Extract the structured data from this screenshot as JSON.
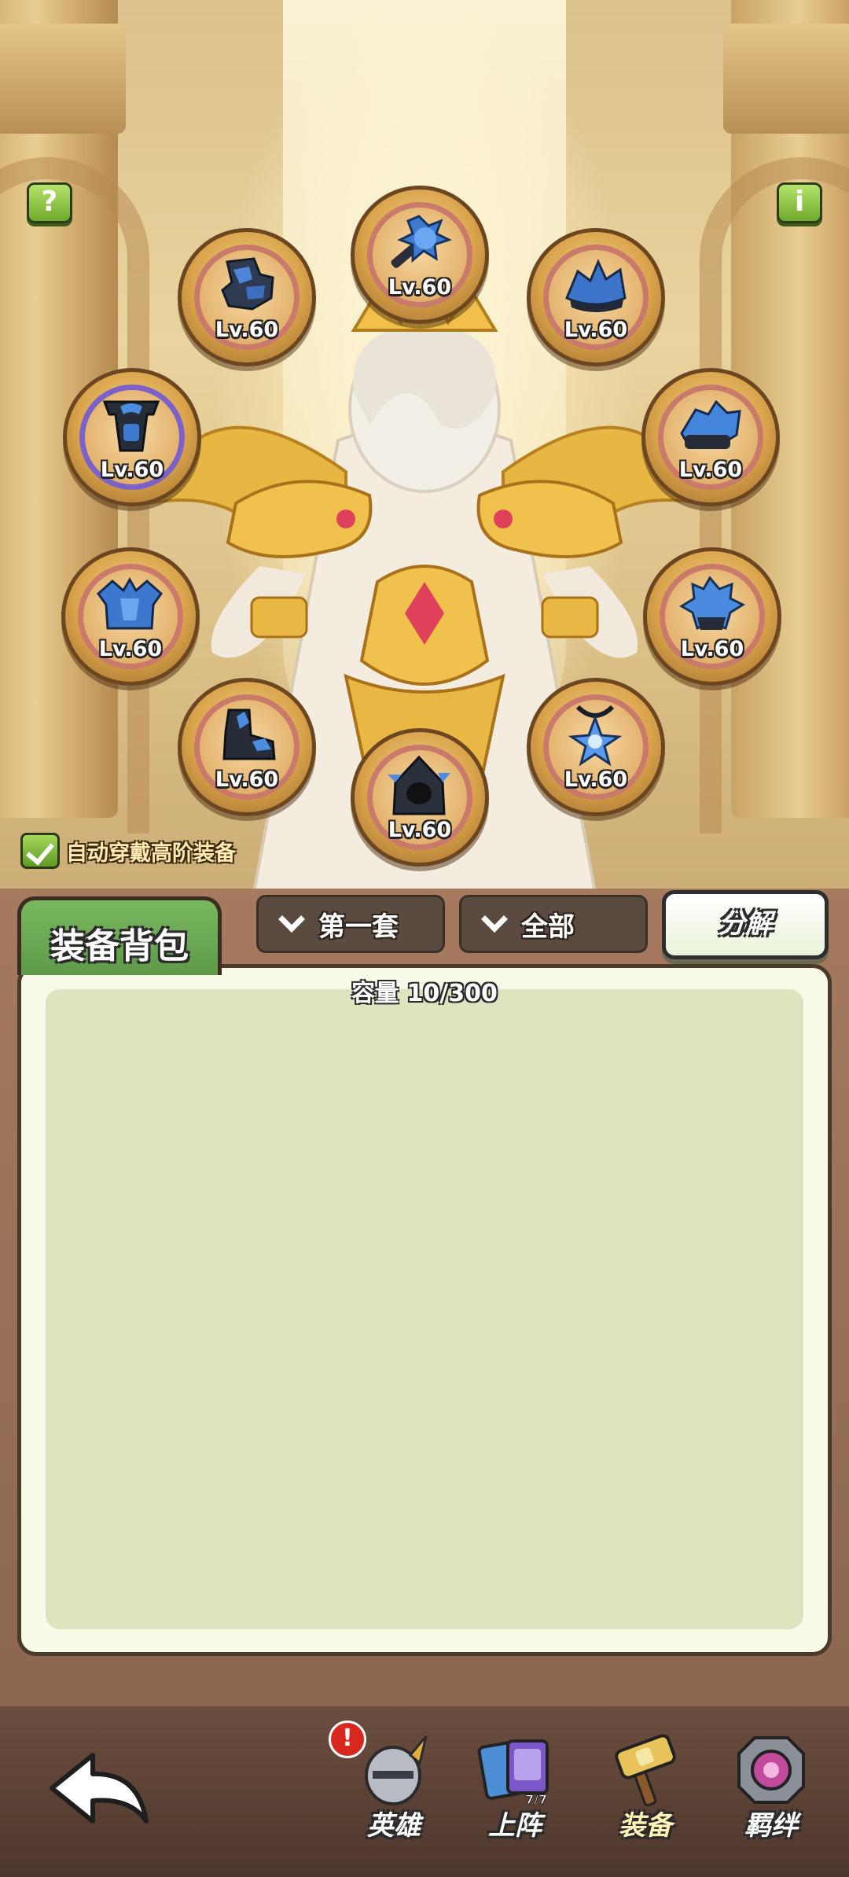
{
  "corner": {
    "help_label": "?",
    "info_label": "i"
  },
  "slots": [
    {
      "level": "Lv.60",
      "icon": "mace-icon",
      "rim": "red"
    },
    {
      "level": "Lv.60",
      "icon": "leg-armor-icon",
      "rim": "gold"
    },
    {
      "level": "Lv.60",
      "icon": "shoulder-armor-icon",
      "rim": "gold"
    },
    {
      "level": "Lv.60",
      "icon": "helmet-icon",
      "rim": "purple"
    },
    {
      "level": "Lv.60",
      "icon": "gauntlet-icon",
      "rim": "red"
    },
    {
      "level": "Lv.60",
      "icon": "chest-armor-icon",
      "rim": "gold"
    },
    {
      "level": "Lv.60",
      "icon": "crystal-bracer-icon",
      "rim": "gold"
    },
    {
      "level": "Lv.60",
      "icon": "boot-icon",
      "rim": "gold"
    },
    {
      "level": "Lv.60",
      "icon": "amulet-icon",
      "rim": "red"
    },
    {
      "level": "Lv.60",
      "icon": "hood-icon",
      "rim": "red"
    }
  ],
  "auto_equip": {
    "label": "自动穿戴高阶装备",
    "checked": true
  },
  "bag": {
    "tab_label": "装备背包",
    "set_dropdown": "第一套",
    "filter_dropdown": "全部",
    "dismantle_label": "分解",
    "capacity": "容量 10/300"
  },
  "nav": {
    "back_icon": "back-arrow-icon",
    "alert": "!",
    "items": [
      {
        "label": "英雄",
        "icon": "knight-helmet-icon"
      },
      {
        "label": "上阵",
        "icon": "cards-icon",
        "badge": "7/7"
      },
      {
        "label": "装备",
        "icon": "hammer-icon",
        "active": true
      },
      {
        "label": "羁绊",
        "icon": "bond-gem-icon"
      }
    ]
  },
  "colors": {
    "accent_green": "#6fa92b",
    "panel": "#f8fbe8",
    "slot_gold": "#d8a24a"
  }
}
